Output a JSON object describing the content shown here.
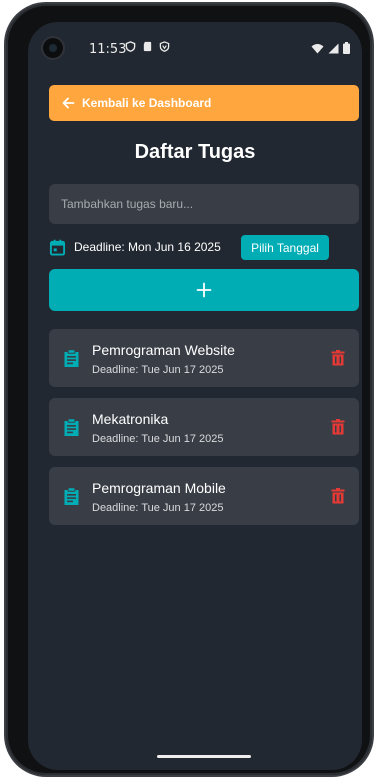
{
  "status_bar": {
    "time": "11:53",
    "left_icons": [
      "shield-icon",
      "sd-card-icon",
      "vpn-icon"
    ],
    "right_icons": [
      "wifi-icon",
      "signal-icon",
      "battery-icon"
    ]
  },
  "back_button": {
    "label": "Kembali ke Dashboard",
    "icon": "arrow-left-icon"
  },
  "page_title": "Daftar Tugas",
  "new_task_input": {
    "placeholder": "Tambahkan tugas baru...",
    "value": ""
  },
  "deadline": {
    "label": "Deadline: Mon Jun 16 2025",
    "icon": "calendar-icon",
    "pick_button_label": "Pilih Tanggal"
  },
  "add_button": {
    "label": "+",
    "icon": "plus-icon"
  },
  "tasks": [
    {
      "title": "Pemrograman Website",
      "deadline": "Deadline: Tue Jun 17 2025"
    },
    {
      "title": "Mekatronika",
      "deadline": "Deadline: Tue Jun 17 2025"
    },
    {
      "title": "Pemrograman Mobile",
      "deadline": "Deadline: Tue Jun 17 2025"
    }
  ],
  "colors": {
    "background": "#222831",
    "card": "#393e46",
    "accent_teal": "#00adb5",
    "back_button_orange": "#ffa63e",
    "delete_red": "#e53935"
  }
}
